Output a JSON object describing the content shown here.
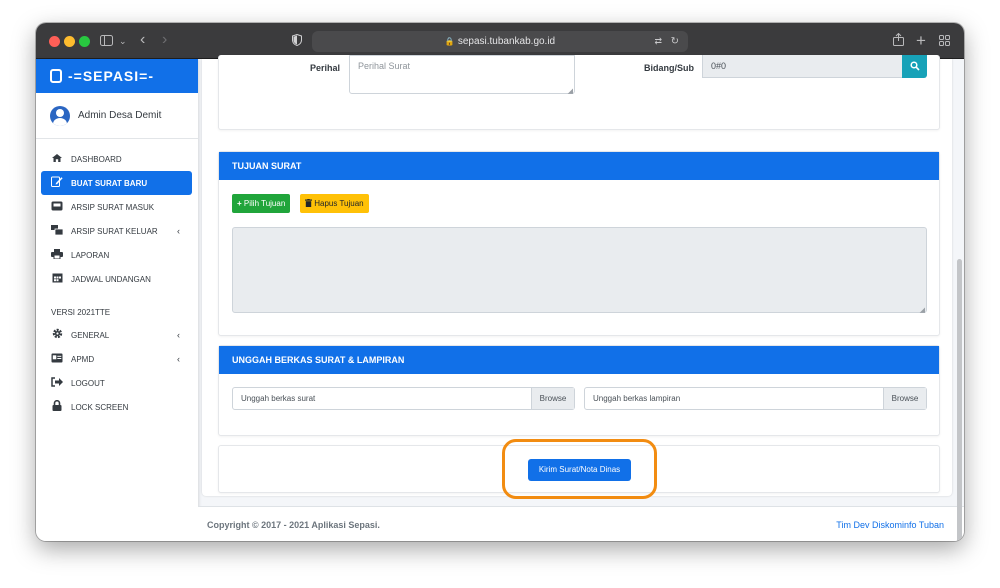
{
  "browser": {
    "url": "sepasi.tubankab.go.id"
  },
  "app": {
    "brand": "-=SEPASI=-",
    "user_name": "Admin Desa Demit"
  },
  "sidebar": {
    "items": [
      {
        "label": "DASHBOARD",
        "icon": "tachometer-icon"
      },
      {
        "label": "BUAT SURAT BARU",
        "icon": "edit-icon"
      },
      {
        "label": "ARSIP SURAT MASUK",
        "icon": "inbox-icon"
      },
      {
        "label": "ARSIP SURAT KELUAR",
        "icon": "mail-bulk-icon"
      },
      {
        "label": "LAPORAN",
        "icon": "print-icon"
      },
      {
        "label": "JADWAL UNDANGAN",
        "icon": "calendar-icon"
      }
    ],
    "version_header": "VERSI 2021TTE",
    "items2": [
      {
        "label": "GENERAL",
        "icon": "gear-icon"
      },
      {
        "label": "APMD",
        "icon": "id-card-icon"
      },
      {
        "label": "LOGOUT",
        "icon": "sign-out-icon"
      },
      {
        "label": "LOCK SCREEN",
        "icon": "lock-icon"
      }
    ]
  },
  "form": {
    "perihal_label": "Perihal",
    "perihal_placeholder": "Perihal Surat",
    "bidang_label": "Bidang/Sub",
    "bidang_value": "0#0"
  },
  "tujuan": {
    "title": "TUJUAN SURAT",
    "pilih_label": "Pilih Tujuan",
    "hapus_label": "Hapus Tujuan"
  },
  "unggah": {
    "title": "UNGGAH BERKAS SURAT & LAMPIRAN",
    "surat_placeholder": "Unggah berkas surat",
    "lampiran_placeholder": "Unggah berkas lampiran",
    "browse_label": "Browse"
  },
  "submit": {
    "label": "Kirim Surat/Nota Dinas"
  },
  "footer": {
    "copyright": "Copyright © 2017 - 2021 Aplikasi Sepasi.",
    "credit": "Tim Dev Diskominfo Tuban"
  },
  "colors": {
    "primary": "#1170e8",
    "success": "#20a53b",
    "warning": "#ffc107",
    "highlight": "#f28c11",
    "titlebar": "#3b3b3d"
  }
}
